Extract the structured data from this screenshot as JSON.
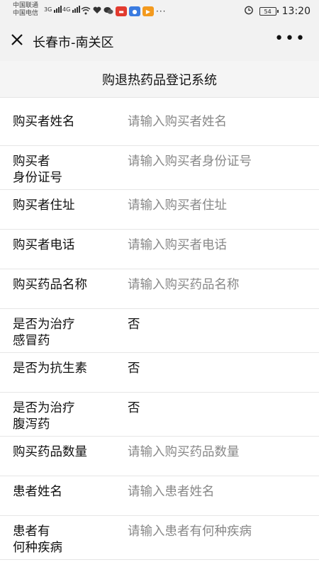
{
  "status_bar": {
    "carrier1": "中国联通",
    "carrier2": "中国电信",
    "net1": "3G",
    "net2": "4G",
    "battery": "54",
    "time": "13:20"
  },
  "nav": {
    "title": "长春市-南关区",
    "close_label": "✕",
    "menu_label": "•••"
  },
  "page": {
    "title": "购退热药品登记系统"
  },
  "form": {
    "rows": [
      {
        "label": "购买者姓名",
        "value": "请输入购买者姓名",
        "placeholder": true
      },
      {
        "label": "购买者\n身份证号",
        "value": "请输入购买者身份证号",
        "placeholder": true
      },
      {
        "label": "购买者住址",
        "value": "请输入购买者住址",
        "placeholder": true
      },
      {
        "label": "购买者电话",
        "value": "请输入购买者电话",
        "placeholder": true
      },
      {
        "label": "购买药品名称",
        "value": "请输入购买药品名称",
        "placeholder": true
      },
      {
        "label": "是否为治疗\n感冒药",
        "value": "否",
        "placeholder": false
      },
      {
        "label": "是否为抗生素",
        "value": "否",
        "placeholder": false
      },
      {
        "label": "是否为治疗\n腹泻药",
        "value": "否",
        "placeholder": false
      },
      {
        "label": "购买药品数量",
        "value": "请输入购买药品数量",
        "placeholder": true
      },
      {
        "label": "患者姓名",
        "value": "请输入患者姓名",
        "placeholder": true
      },
      {
        "label": "患者有\n何种疾病",
        "value": "请输入患者有何种疾病",
        "placeholder": true
      }
    ]
  },
  "colors": {
    "placeholder": "#888888",
    "text": "#111111",
    "divider": "#e6e6e6"
  }
}
